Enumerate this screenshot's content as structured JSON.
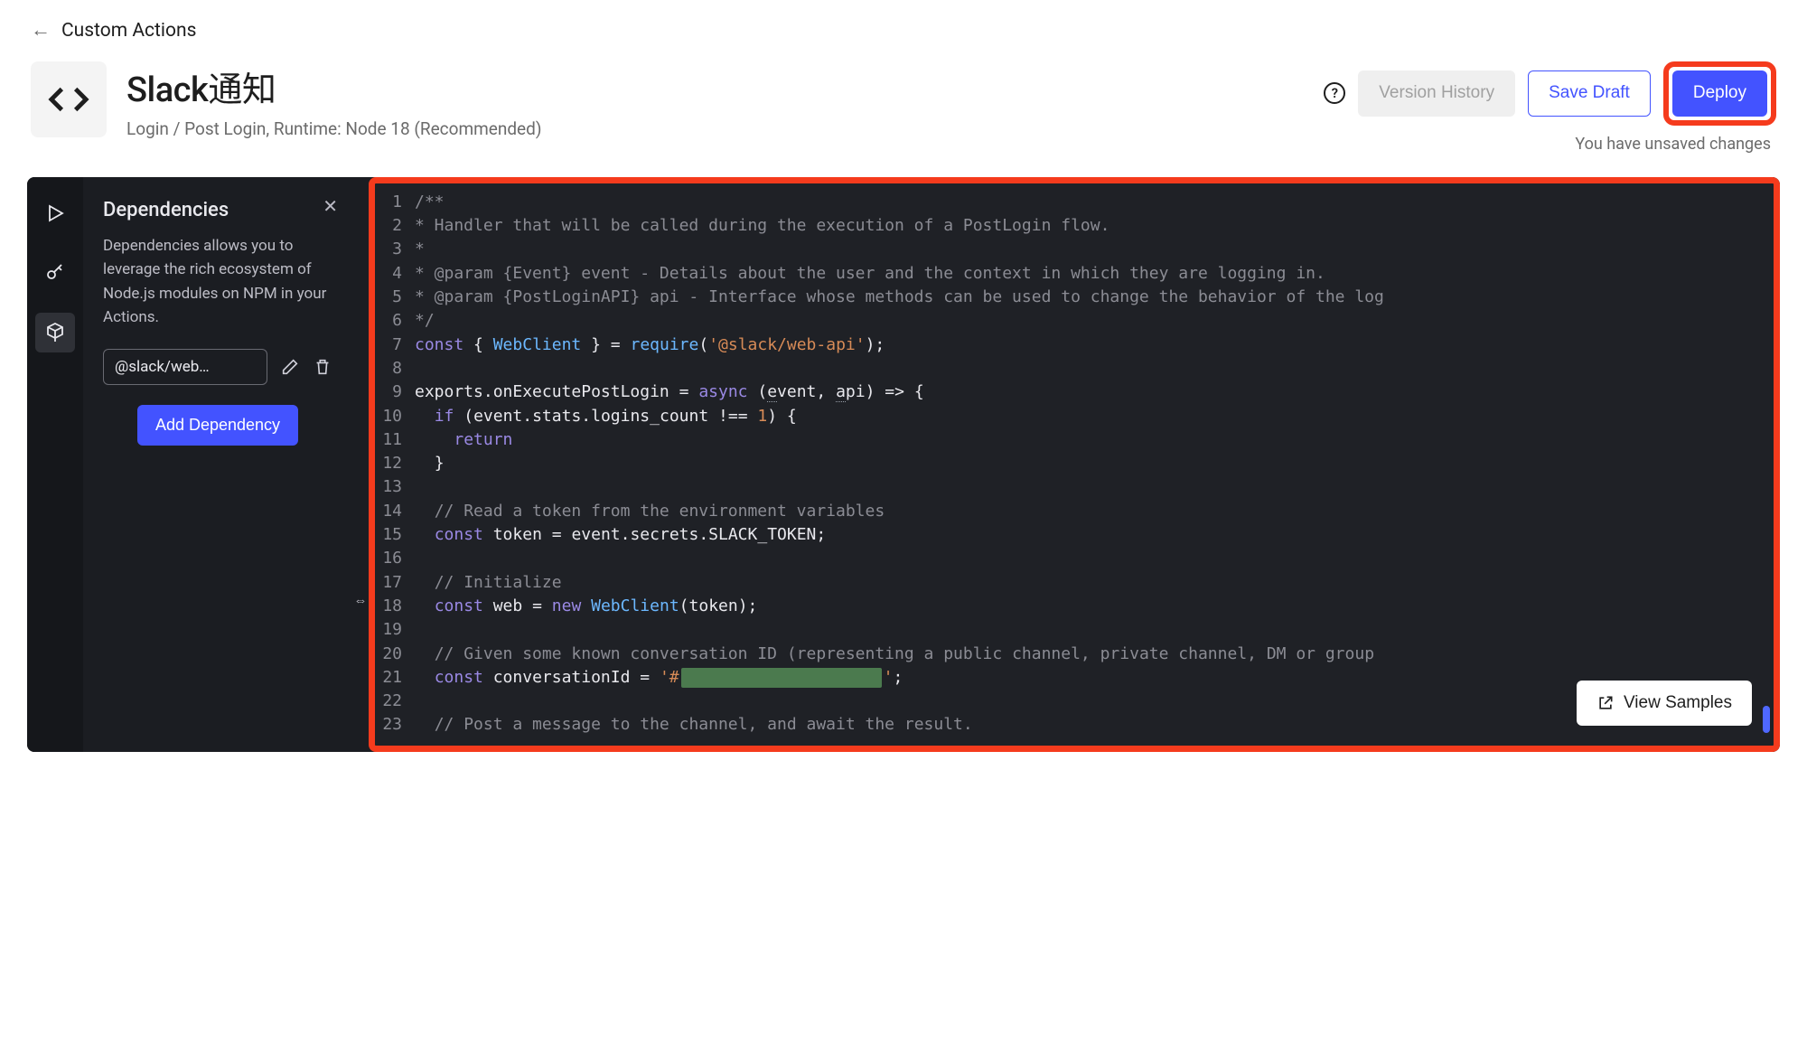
{
  "breadcrumb": {
    "label": "Custom Actions"
  },
  "header": {
    "title": "Slack通知",
    "subtitle": "Login / Post Login, Runtime: Node 18 (Recommended)"
  },
  "actions": {
    "version_history": "Version History",
    "save_draft": "Save Draft",
    "deploy": "Deploy",
    "unsaved_note": "You have unsaved changes",
    "view_samples": "View Samples"
  },
  "panel": {
    "title": "Dependencies",
    "description": "Dependencies allows you to leverage the rich ecosystem of Node.js modules on NPM in your Actions.",
    "dep_display": "@slack/web…",
    "add_button": "Add Dependency"
  },
  "code": {
    "lines_plain": [
      "/**",
      "* Handler that will be called during the execution of a PostLogin flow.",
      "*",
      "* @param {Event} event - Details about the user and the context in which they are logging in.",
      "* @param {PostLoginAPI} api - Interface whose methods can be used to change the behavior of the log",
      "*/",
      "const { WebClient } = require('@slack/web-api');",
      "",
      "exports.onExecutePostLogin = async (event, api) => {",
      "  if (event.stats.logins_count !== 1) {",
      "    return",
      "  }",
      "",
      "  // Read a token from the environment variables",
      "  const token = event.secrets.SLACK_TOKEN;",
      "",
      "  // Initialize",
      "  const web = new WebClient(token);",
      "",
      "  // Given some known conversation ID (representing a public channel, private channel, DM or group",
      "  const conversationId = '#REDACTED';",
      "",
      "  // Post a message to the channel, and await the result."
    ]
  }
}
